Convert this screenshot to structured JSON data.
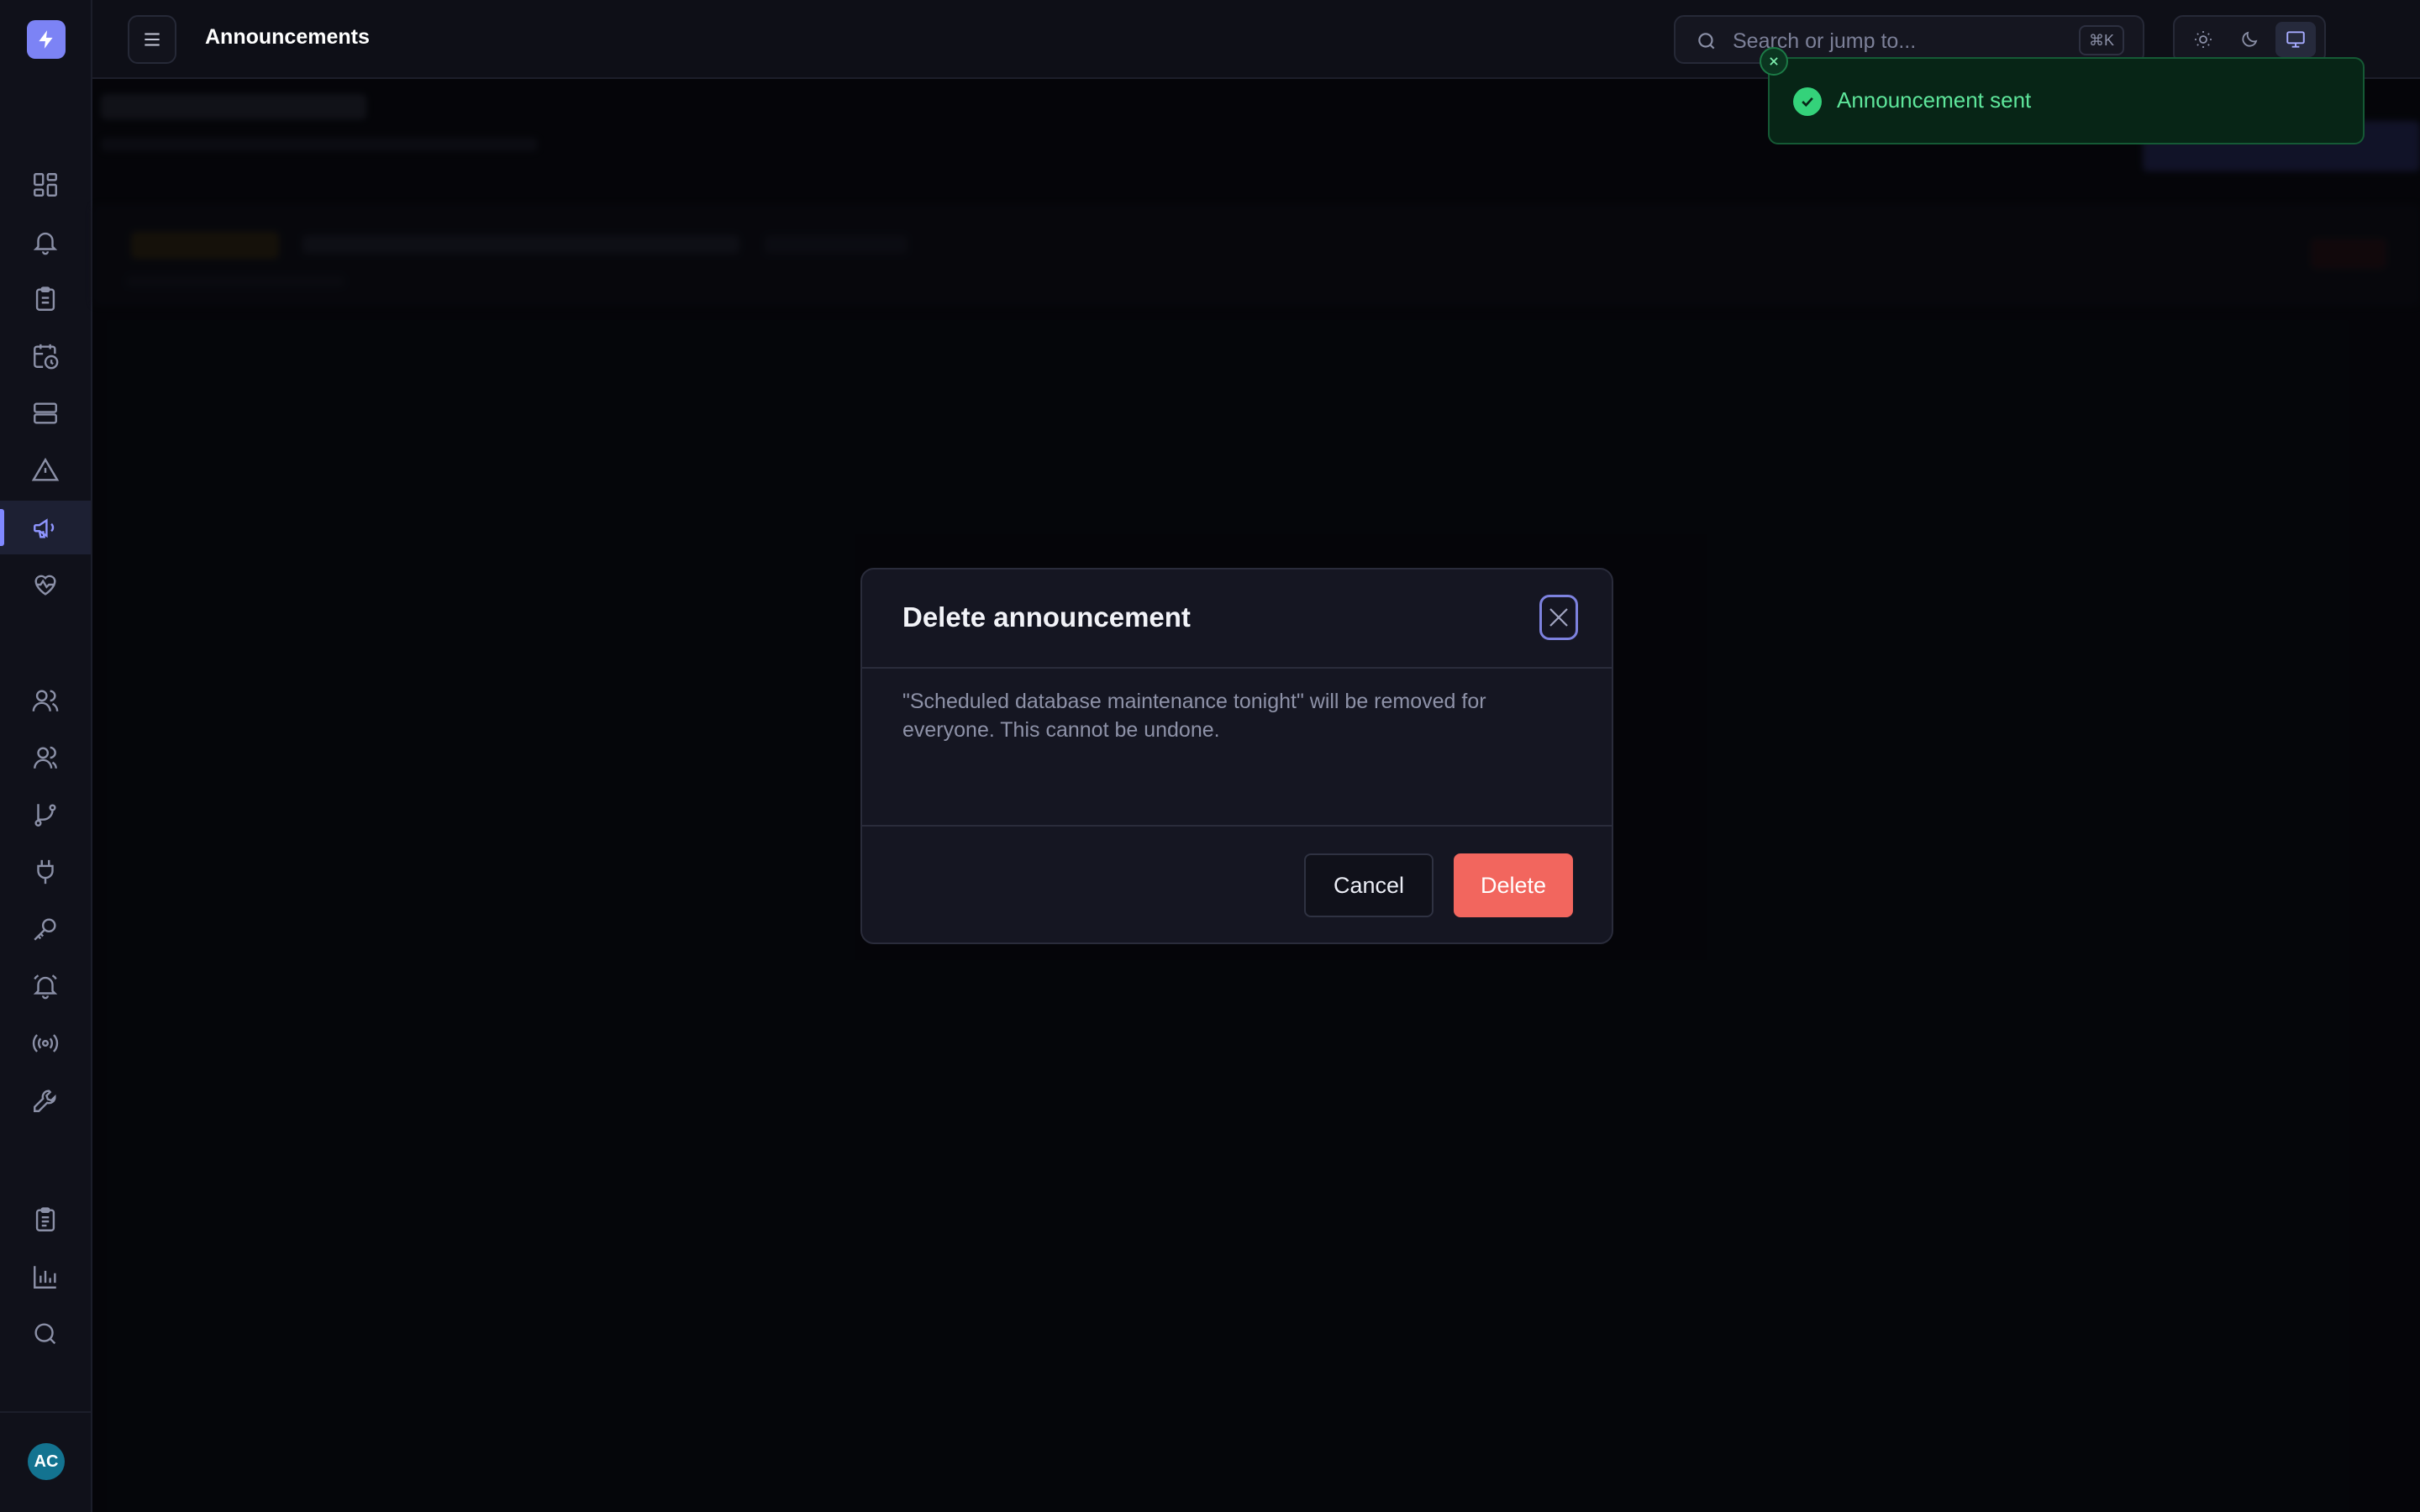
{
  "app": {
    "logo_icon": "bolt-icon",
    "accent_color": "#7c83f5"
  },
  "topbar": {
    "title": "Announcements",
    "search": {
      "placeholder": "Search or jump to...",
      "shortcut": "⌘K"
    },
    "theme_options": [
      "sun-icon",
      "moon-icon",
      "monitor-icon"
    ],
    "theme_selected": "system",
    "user_initials": "AC"
  },
  "sidebar": {
    "active_item": "announcements",
    "items": [
      {
        "id": "dashboard",
        "icon": "dashboard-icon"
      },
      {
        "id": "notifications",
        "icon": "bell-icon"
      },
      {
        "id": "tasks",
        "icon": "clipboard-icon"
      },
      {
        "id": "schedule",
        "icon": "calendar-clock-icon"
      },
      {
        "id": "servers",
        "icon": "server-icon"
      },
      {
        "id": "alerts",
        "icon": "warning-icon"
      },
      {
        "id": "announcements",
        "icon": "megaphone-icon"
      },
      {
        "id": "health",
        "icon": "heart-pulse-icon"
      },
      {
        "id": "users",
        "icon": "user-icon"
      },
      {
        "id": "teams",
        "icon": "users-icon"
      },
      {
        "id": "workflows",
        "icon": "git-branch-icon"
      },
      {
        "id": "integrations",
        "icon": "plug-icon"
      },
      {
        "id": "api-keys",
        "icon": "key-icon"
      },
      {
        "id": "alert-rules",
        "icon": "bell-ring-icon"
      },
      {
        "id": "broadcast",
        "icon": "broadcast-icon"
      },
      {
        "id": "tools",
        "icon": "wrench-icon"
      },
      {
        "id": "reports",
        "icon": "clipboard-list-icon"
      },
      {
        "id": "analytics",
        "icon": "bar-chart-icon"
      },
      {
        "id": "search",
        "icon": "search-icon"
      }
    ],
    "user_initials": "AC"
  },
  "toast": {
    "message": "Announcement sent",
    "status_color": "#34d27a"
  },
  "modal": {
    "title": "Delete announcement",
    "body": "\"Scheduled database maintenance tonight\" will be removed for everyone. This cannot be undone.",
    "cancel_label": "Cancel",
    "delete_label": "Delete",
    "danger_color": "#f2665e"
  }
}
